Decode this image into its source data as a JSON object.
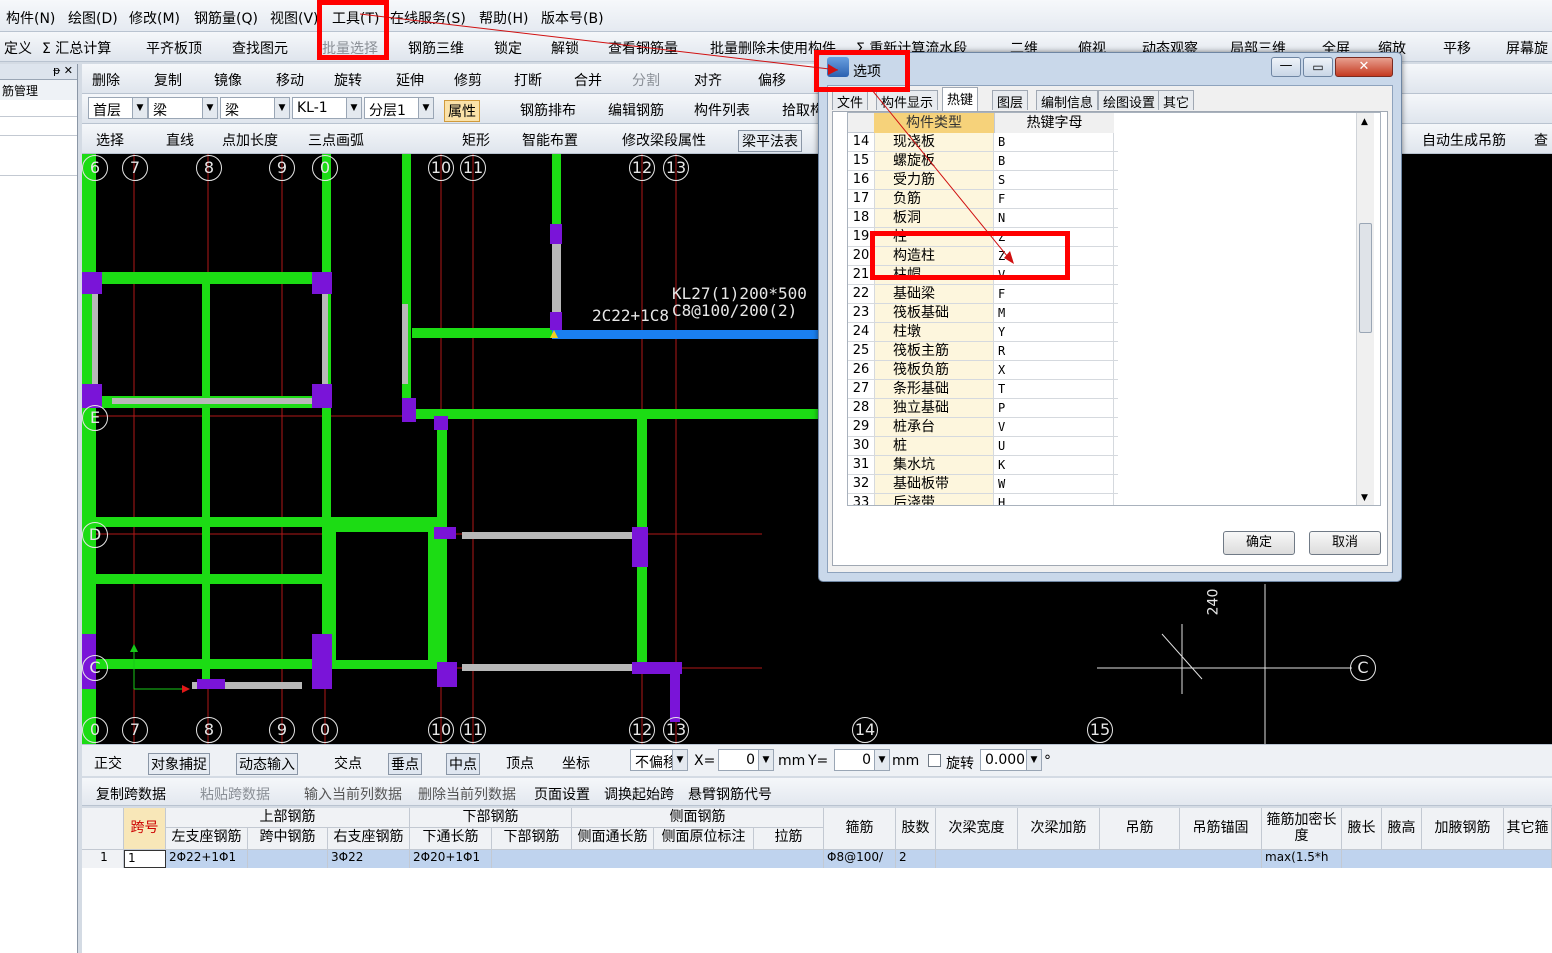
{
  "menu": [
    "构件(N)",
    "绘图(D)",
    "修改(M)",
    "钢筋量(Q)",
    "视图(V)",
    "工具(T)",
    "在线服务(S)",
    "帮助(H)",
    "版本号(B)"
  ],
  "toolbar1": [
    "定义",
    "Σ 汇总计算",
    "平齐板顶",
    "查找图元",
    "批量选择",
    "钢筋三维",
    "锁定",
    "解锁",
    "查看钢筋量",
    "批量删除未使用构件",
    "Σ 重新计算流水段",
    "二维",
    "俯视",
    "动态观察",
    "局部三维",
    "全屏",
    "缩放",
    "平移",
    "屏幕旋"
  ],
  "toolbar2": [
    "删除",
    "复制",
    "镜像",
    "移动",
    "旋转",
    "延伸",
    "修剪",
    "打断",
    "合并",
    "分割",
    "对齐",
    "偏移"
  ],
  "toolbar3": {
    "floor": "首层",
    "type1": "梁",
    "type2": "梁",
    "name": "KL-1",
    "layer": "分层1",
    "btns": [
      "属性",
      "钢筋排布",
      "编辑钢筋",
      "构件列表",
      "拾取构"
    ]
  },
  "toolbar4": [
    "选择",
    "直线",
    "点加长度",
    "三点画弧",
    "矩形",
    "智能布置",
    "修改梁段属性",
    "梁平法表",
    "自动生成吊筋",
    "查"
  ],
  "left_panel": {
    "title": "筋管理"
  },
  "canvas": {
    "top_axes": [
      "6",
      "7",
      "8",
      "9",
      "0",
      "10",
      "11",
      "12",
      "13"
    ],
    "bottom_axes": [
      "0",
      "7",
      "8",
      "9",
      "0",
      "10",
      "11",
      "12",
      "13",
      "14",
      "15"
    ],
    "side_axes": [
      "E",
      "D",
      "C",
      "C"
    ],
    "beam_label1": "KL27(1)200*500",
    "beam_label2": "C8@100/200(2)",
    "beam_label3": "2C22+1C8",
    "dim_label": "240"
  },
  "status": {
    "items": [
      "正交",
      "对象捕捉",
      "动态输入",
      "交点",
      "垂点",
      "中点",
      "顶点",
      "坐标"
    ],
    "mode": "不偏移",
    "x_label": "X=",
    "x_val": "0",
    "x_unit": "mm",
    "y_label": "Y=",
    "y_val": "0",
    "y_unit": "mm",
    "rotate": "旋转",
    "rotate_val": "0.000",
    "deg": "°"
  },
  "bottom_toolbar": [
    "复制跨数据",
    "粘贴跨数据",
    "输入当前列数据",
    "删除当前列数据",
    "页面设置",
    "调换起始跨",
    "悬臂钢筋代号"
  ],
  "grid": {
    "groups": [
      "上部钢筋",
      "下部钢筋",
      "侧面钢筋"
    ],
    "headers": [
      "跨号",
      "左支座钢筋",
      "跨中钢筋",
      "右支座钢筋",
      "下通长筋",
      "下部钢筋",
      "侧面通长筋",
      "侧面原位标注",
      "拉筋",
      "箍筋",
      "肢数",
      "次梁宽度",
      "次梁加筋",
      "吊筋",
      "吊筋锚固",
      "箍筋加密长度",
      "腋长",
      "腋高",
      "加腋钢筋",
      "其它箍"
    ],
    "row": {
      "idx": "1",
      "span": "1",
      "left": "2Φ22+1Φ1",
      "mid": "",
      "right": "3Φ22",
      "bottom_through": "2Φ20+1Φ1",
      "stirrup": "Φ8@100/",
      "legs": "2",
      "dense": "max(1.5*h"
    }
  },
  "dialog": {
    "title": "选项",
    "tabs": [
      "文件",
      "构件显示",
      "热键",
      "图层",
      "编制信息",
      "绘图设置",
      "其它"
    ],
    "active_tab": "热键",
    "col1": "构件类型",
    "col2": "热键字母",
    "rows": [
      {
        "n": "14",
        "t": "现浇板",
        "k": "B"
      },
      {
        "n": "15",
        "t": "螺旋板",
        "k": "B"
      },
      {
        "n": "16",
        "t": "受力筋",
        "k": "S"
      },
      {
        "n": "17",
        "t": "负筋",
        "k": "F"
      },
      {
        "n": "18",
        "t": "板洞",
        "k": "N"
      },
      {
        "n": "19",
        "t": "柱",
        "k": "Z"
      },
      {
        "n": "20",
        "t": "构造柱",
        "k": "Z"
      },
      {
        "n": "21",
        "t": "柱帽",
        "k": "V"
      },
      {
        "n": "22",
        "t": "基础梁",
        "k": "F"
      },
      {
        "n": "23",
        "t": "筏板基础",
        "k": "M"
      },
      {
        "n": "24",
        "t": "柱墩",
        "k": "Y"
      },
      {
        "n": "25",
        "t": "筏板主筋",
        "k": "R"
      },
      {
        "n": "26",
        "t": "筏板负筋",
        "k": "X"
      },
      {
        "n": "27",
        "t": "条形基础",
        "k": "T"
      },
      {
        "n": "28",
        "t": "独立基础",
        "k": "P"
      },
      {
        "n": "29",
        "t": "桩承台",
        "k": "V"
      },
      {
        "n": "30",
        "t": "桩",
        "k": "U"
      },
      {
        "n": "31",
        "t": "集水坑",
        "k": "K"
      },
      {
        "n": "32",
        "t": "基础板带",
        "k": "W"
      },
      {
        "n": "33",
        "t": "后浇带",
        "k": "H"
      }
    ],
    "ok": "确定",
    "cancel": "取消"
  },
  "colors": {
    "beam": "#1cdc14",
    "column": "#7a14d8",
    "highlight": "#ff0000",
    "selected_beam": "#1a7ff0"
  }
}
